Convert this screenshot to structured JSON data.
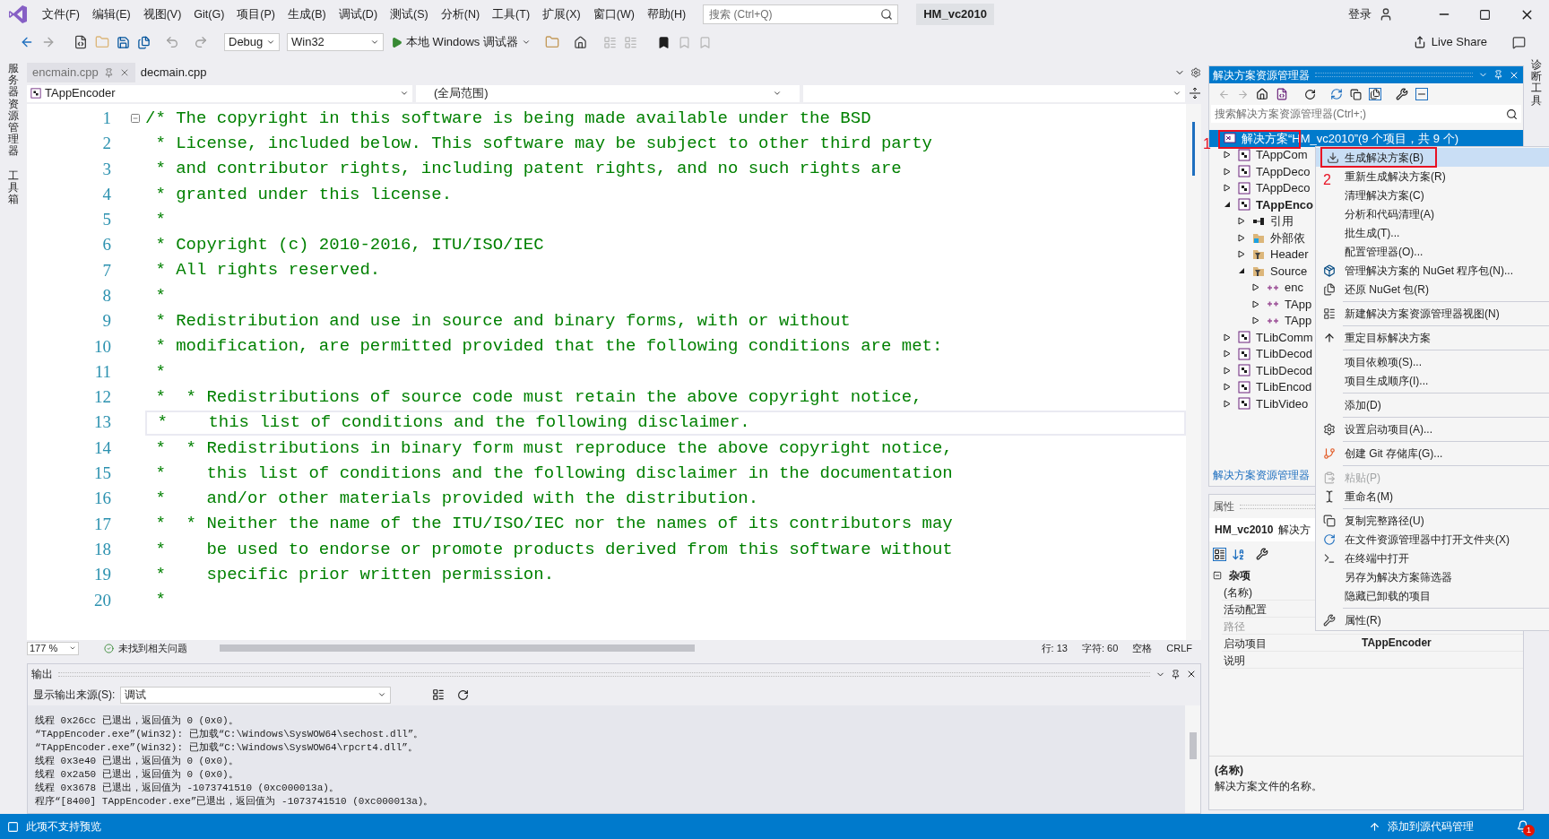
{
  "menu_bar": {
    "items": [
      "文件(F)",
      "编辑(E)",
      "视图(V)",
      "Git(G)",
      "项目(P)",
      "生成(B)",
      "调试(D)",
      "测试(S)",
      "分析(N)",
      "工具(T)",
      "扩展(X)",
      "窗口(W)",
      "帮助(H)"
    ],
    "search": {
      "placeholder": "搜索 (Ctrl+Q)"
    },
    "solution_name": "HM_vc2010",
    "sign_in": "登录"
  },
  "toolbar": {
    "configuration": "Debug",
    "platform": "Win32",
    "run": "本地 Windows 调试器",
    "live_share": "Live Share"
  },
  "side_tabs_left": [
    "服务器资源管理器",
    "工具箱"
  ],
  "side_tabs_right": [
    "诊断工具"
  ],
  "editor": {
    "tabs": [
      {
        "label": "encmain.cpp",
        "selected": false
      },
      {
        "label": "decmain.cpp",
        "selected": true
      }
    ],
    "scope": "TAppEncoder",
    "member": "(全局范围)",
    "lines": [
      {
        "number": "1",
        "text": "/* The copyright in this software is being made available under the BSD",
        "current": false
      },
      {
        "number": "2",
        "text": " * License, included below. This software may be subject to other third party",
        "current": false
      },
      {
        "number": "3",
        "text": " * and contributor rights, including patent rights, and no such rights are",
        "current": false
      },
      {
        "number": "4",
        "text": " * granted under this license.",
        "current": false
      },
      {
        "number": "5",
        "text": " *",
        "current": false
      },
      {
        "number": "6",
        "text": " * Copyright (c) 2010-2016, ITU/ISO/IEC",
        "current": false
      },
      {
        "number": "7",
        "text": " * All rights reserved.",
        "current": false
      },
      {
        "number": "8",
        "text": " *",
        "current": false
      },
      {
        "number": "9",
        "text": " * Redistribution and use in source and binary forms, with or without",
        "current": false
      },
      {
        "number": "10",
        "text": " * modification, are permitted provided that the following conditions are met:",
        "current": false
      },
      {
        "number": "11",
        "text": " *",
        "current": false
      },
      {
        "number": "12",
        "text": " *  * Redistributions of source code must retain the above copyright notice,",
        "current": false
      },
      {
        "number": "13",
        "text": " *    this list of conditions and the following disclaimer.",
        "current": true
      },
      {
        "number": "14",
        "text": " *  * Redistributions in binary form must reproduce the above copyright notice,",
        "current": false
      },
      {
        "number": "15",
        "text": " *    this list of conditions and the following disclaimer in the documentation",
        "current": false
      },
      {
        "number": "16",
        "text": " *    and/or other materials provided with the distribution.",
        "current": false
      },
      {
        "number": "17",
        "text": " *  * Neither the name of the ITU/ISO/IEC nor the names of its contributors may",
        "current": false
      },
      {
        "number": "18",
        "text": " *    be used to endorse or promote products derived from this software without",
        "current": false
      },
      {
        "number": "19",
        "text": " *    specific prior written permission.",
        "current": false
      },
      {
        "number": "20",
        "text": " *",
        "current": false
      }
    ]
  },
  "editor_status": {
    "zoom": "177 %",
    "issues": "未找到相关问题",
    "line": "行: 13",
    "char": "字符: 60",
    "whitespace": "空格",
    "eol": "CRLF"
  },
  "output": {
    "title": "输出",
    "source_label": "显示输出来源(S):",
    "source": "调试",
    "lines": [
      "线程 0x26cc 已退出，返回值为 0 (0x0)。",
      "“TAppEncoder.exe”(Win32): 已加载“C:\\Windows\\SysWOW64\\sechost.dll”。",
      "“TAppEncoder.exe”(Win32): 已加载“C:\\Windows\\SysWOW64\\rpcrt4.dll”。",
      "线程 0x3e40 已退出，返回值为 0 (0x0)。",
      "线程 0x2a50 已退出，返回值为 0 (0x0)。",
      "线程 0x3678 已退出，返回值为 -1073741510 (0xc000013a)。",
      "程序“[8400] TAppEncoder.exe”已退出，返回值为 -1073741510 (0xc000013a)。"
    ]
  },
  "solution_explorer": {
    "title": "解决方案资源管理器",
    "search": {
      "placeholder": "搜索解决方案资源管理器(Ctrl+;)"
    },
    "root": {
      "label": "解决方案“HM_vc2010”(9 个项目，共 9 个)",
      "selected": true
    },
    "tree": [
      {
        "kind": "project",
        "label": "TAppCom",
        "expanded": false,
        "startup": false
      },
      {
        "kind": "project",
        "label": "TAppDeco",
        "expanded": false,
        "startup": false
      },
      {
        "kind": "project",
        "label": "TAppDeco",
        "expanded": false,
        "startup": false
      },
      {
        "kind": "project",
        "label": "TAppEnco",
        "expanded": true,
        "startup": true,
        "children": [
          {
            "kind": "references",
            "label": "引用",
            "expanded": false,
            "startup": false
          },
          {
            "kind": "external",
            "label": "外部依",
            "expanded": false,
            "startup": false
          },
          {
            "kind": "filter",
            "label": "Header",
            "expanded": false,
            "startup": false
          },
          {
            "kind": "filter",
            "label": "Source",
            "expanded": true,
            "startup": false,
            "children": [
              {
                "kind": "file",
                "label": "enc",
                "expanded": false,
                "startup": false
              },
              {
                "kind": "file",
                "label": "TApp",
                "expanded": false,
                "startup": false
              },
              {
                "kind": "file",
                "label": "TApp",
                "expanded": false,
                "startup": false
              }
            ]
          }
        ]
      },
      {
        "kind": "project",
        "label": "TLibComm",
        "expanded": false,
        "startup": false
      },
      {
        "kind": "project",
        "label": "TLibDecod",
        "expanded": false,
        "startup": false
      },
      {
        "kind": "project",
        "label": "TLibDecod",
        "expanded": false,
        "startup": false
      },
      {
        "kind": "project",
        "label": "TLibEncod",
        "expanded": false,
        "startup": false
      },
      {
        "kind": "project",
        "label": "TLibVideo",
        "expanded": false,
        "startup": false
      }
    ],
    "footer_tab": "解决方案资源管理器"
  },
  "properties": {
    "title": "属性",
    "object": "HM_vc2010",
    "object_type": "解决方",
    "category": "杂项",
    "rows": [
      {
        "name": "(名称)",
        "value": "",
        "disabled": false
      },
      {
        "name": "活动配置",
        "value": "",
        "disabled": false
      },
      {
        "name": "路径",
        "value": "",
        "disabled": true
      },
      {
        "name": "启动项目",
        "value": "TAppEncoder",
        "disabled": false
      },
      {
        "name": "说明",
        "value": "",
        "disabled": false
      }
    ],
    "description_title": "(名称)",
    "description": "解决方案文件的名称。"
  },
  "context_menu": {
    "items": [
      {
        "kind": "item",
        "label": "生成解决方案(B)",
        "selected": true,
        "disabled": false
      },
      {
        "kind": "item",
        "label": "重新生成解决方案(R)",
        "selected": false,
        "disabled": false
      },
      {
        "kind": "item",
        "label": "清理解决方案(C)",
        "selected": false,
        "disabled": false
      },
      {
        "kind": "item",
        "label": "分析和代码清理(A)",
        "selected": false,
        "disabled": false
      },
      {
        "kind": "item",
        "label": "批生成(T)...",
        "selected": false,
        "disabled": false
      },
      {
        "kind": "item",
        "label": "配置管理器(O)...",
        "selected": false,
        "disabled": false
      },
      {
        "kind": "item",
        "label": "管理解决方案的 NuGet 程序包(N)...",
        "selected": false,
        "disabled": false
      },
      {
        "kind": "item",
        "label": "还原 NuGet 包(R)",
        "selected": false,
        "disabled": false
      },
      {
        "kind": "separator"
      },
      {
        "kind": "item",
        "label": "新建解决方案资源管理器视图(N)",
        "selected": false,
        "disabled": false
      },
      {
        "kind": "separator"
      },
      {
        "kind": "item",
        "label": "重定目标解决方案",
        "selected": false,
        "disabled": false
      },
      {
        "kind": "separator"
      },
      {
        "kind": "item",
        "label": "项目依赖项(S)...",
        "selected": false,
        "disabled": false
      },
      {
        "kind": "item",
        "label": "项目生成顺序(I)...",
        "selected": false,
        "disabled": false
      },
      {
        "kind": "separator"
      },
      {
        "kind": "item",
        "label": "添加(D)",
        "selected": false,
        "disabled": false
      },
      {
        "kind": "separator"
      },
      {
        "kind": "item",
        "label": "设置启动项目(A)...",
        "selected": false,
        "disabled": false
      },
      {
        "kind": "separator"
      },
      {
        "kind": "item",
        "label": "创建 Git 存储库(G)...",
        "selected": false,
        "disabled": false
      },
      {
        "kind": "separator"
      },
      {
        "kind": "item",
        "label": "粘贴(P)",
        "selected": false,
        "disabled": true
      },
      {
        "kind": "item",
        "label": "重命名(M)",
        "selected": false,
        "disabled": false
      },
      {
        "kind": "separator"
      },
      {
        "kind": "item",
        "label": "复制完整路径(U)",
        "selected": false,
        "disabled": false
      },
      {
        "kind": "item",
        "label": "在文件资源管理器中打开文件夹(X)",
        "selected": false,
        "disabled": false
      },
      {
        "kind": "item",
        "label": "在终端中打开",
        "selected": false,
        "disabled": false
      },
      {
        "kind": "item",
        "label": "另存为解决方案筛选器",
        "selected": false,
        "disabled": false
      },
      {
        "kind": "item",
        "label": "隐藏已卸载的项目",
        "selected": false,
        "disabled": false
      },
      {
        "kind": "separator"
      },
      {
        "kind": "item",
        "label": "属性(R)",
        "selected": false,
        "disabled": false
      }
    ]
  },
  "annotations": [
    {
      "label": "1"
    },
    {
      "label": "2"
    }
  ],
  "status_bar": {
    "message": "此项不支持预览",
    "source_control": "添加到源代码管理",
    "notifications": "1"
  }
}
